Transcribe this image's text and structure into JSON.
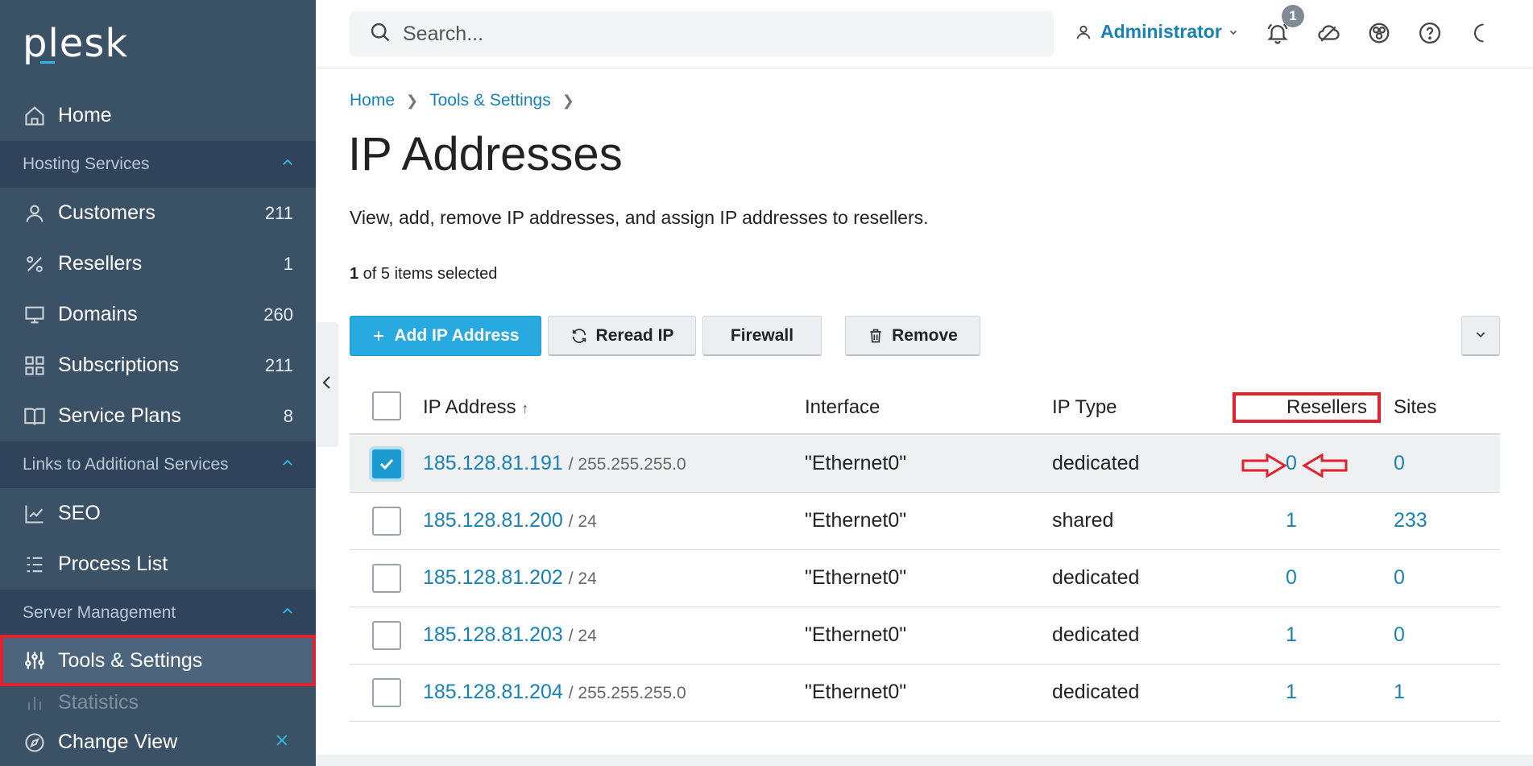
{
  "sidebar": {
    "logo": "plesk",
    "items": [
      {
        "label": "Home",
        "count": "",
        "icon": "home-icon"
      },
      {
        "label": "Customers",
        "count": "211",
        "icon": "user-icon"
      },
      {
        "label": "Resellers",
        "count": "1",
        "icon": "percent-icon"
      },
      {
        "label": "Domains",
        "count": "260",
        "icon": "monitor-icon"
      },
      {
        "label": "Subscriptions",
        "count": "211",
        "icon": "grid-icon"
      },
      {
        "label": "Service Plans",
        "count": "8",
        "icon": "book-icon"
      },
      {
        "label": "SEO",
        "count": "",
        "icon": "chart-icon"
      },
      {
        "label": "Process List",
        "count": "",
        "icon": "list-icon"
      },
      {
        "label": "Tools & Settings",
        "count": "",
        "icon": "sliders-icon"
      },
      {
        "label": "Statistics",
        "count": "",
        "icon": "bar-chart-icon"
      },
      {
        "label": "Change View",
        "count": "",
        "icon": "compass-icon"
      }
    ],
    "sections": [
      "Hosting Services",
      "Links to Additional Services",
      "Server Management"
    ]
  },
  "header": {
    "search_placeholder": "Search...",
    "user": "Administrator",
    "notifications": "1"
  },
  "breadcrumbs": [
    "Home",
    "Tools & Settings"
  ],
  "page": {
    "title": "IP Addresses",
    "description": "View, add, remove IP addresses, and assign IP addresses to resellers.",
    "selected_count": "1",
    "selected_rest": " of 5 items selected"
  },
  "toolbar": {
    "add": "Add IP Address",
    "reread": "Reread IP",
    "firewall": "Firewall",
    "remove": "Remove"
  },
  "table": {
    "columns": [
      "IP Address",
      "Interface",
      "IP Type",
      "Resellers",
      "Sites"
    ],
    "sort_indicator": "↑",
    "rows": [
      {
        "ip": "185.128.81.191",
        "mask": "/ 255.255.255.0",
        "interface": "\"Ethernet0\"",
        "type": "dedicated",
        "resellers": "0",
        "sites": "0",
        "checked": true
      },
      {
        "ip": "185.128.81.200",
        "mask": "/ 24",
        "interface": "\"Ethernet0\"",
        "type": "shared",
        "resellers": "1",
        "sites": "233",
        "checked": false
      },
      {
        "ip": "185.128.81.202",
        "mask": "/ 24",
        "interface": "\"Ethernet0\"",
        "type": "dedicated",
        "resellers": "0",
        "sites": "0",
        "checked": false
      },
      {
        "ip": "185.128.81.203",
        "mask": "/ 24",
        "interface": "\"Ethernet0\"",
        "type": "dedicated",
        "resellers": "1",
        "sites": "0",
        "checked": false
      },
      {
        "ip": "185.128.81.204",
        "mask": "/ 255.255.255.0",
        "interface": "\"Ethernet0\"",
        "type": "dedicated",
        "resellers": "1",
        "sites": "1",
        "checked": false
      }
    ]
  },
  "colors": {
    "sidebar": "#3b5166",
    "accent": "#28aae1",
    "link": "#1782b6",
    "highlight": "#e0232e"
  }
}
